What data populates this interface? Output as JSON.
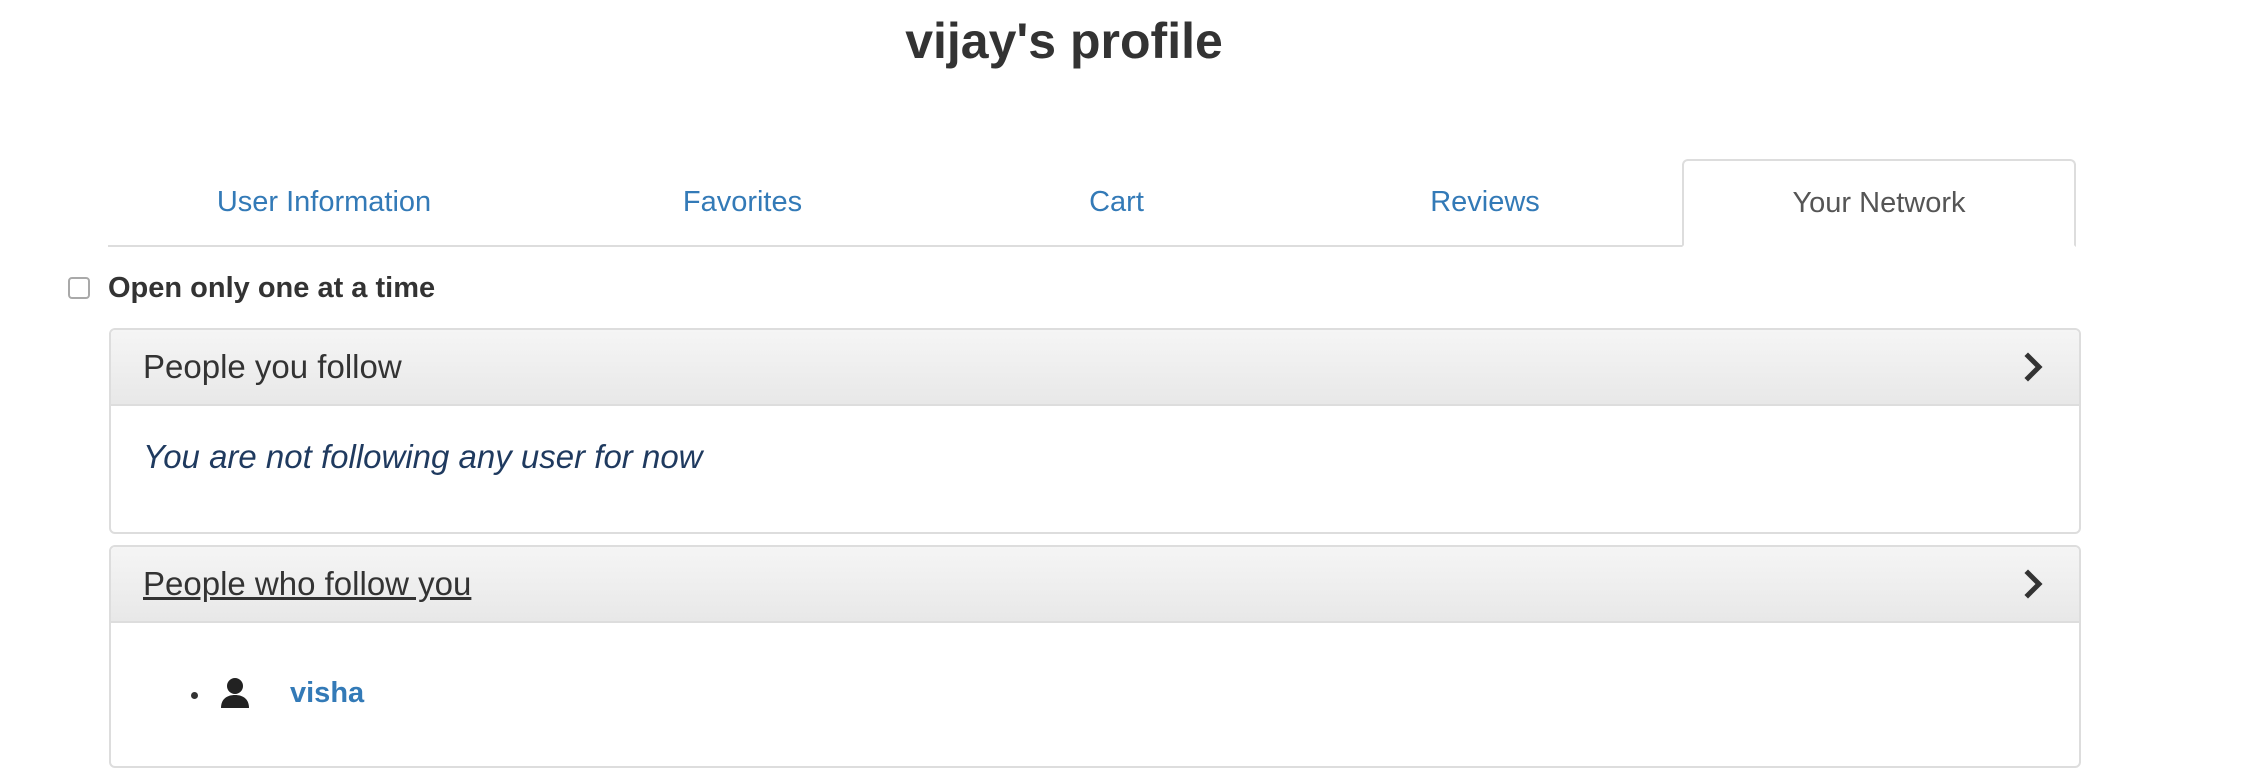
{
  "page": {
    "title": "vijay's profile"
  },
  "tabs": [
    {
      "label": "User Information",
      "active": false
    },
    {
      "label": "Favorites",
      "active": false
    },
    {
      "label": "Cart",
      "active": false
    },
    {
      "label": "Reviews",
      "active": false
    },
    {
      "label": "Your Network",
      "active": true
    }
  ],
  "options": {
    "open_one_label": "Open only one at a time",
    "open_one_checked": false
  },
  "panels": {
    "following": {
      "title": "People you follow",
      "empty_message": "You are not following any user for now",
      "icon": "chevron-right-icon"
    },
    "followers": {
      "title": "People who follow you",
      "icon": "chevron-right-icon",
      "users": [
        {
          "name": "visha",
          "icon": "user-icon"
        }
      ]
    }
  },
  "colors": {
    "link": "#337ab7",
    "text": "#333333",
    "border": "#dddddd",
    "empty_message": "#1f3a5f"
  }
}
